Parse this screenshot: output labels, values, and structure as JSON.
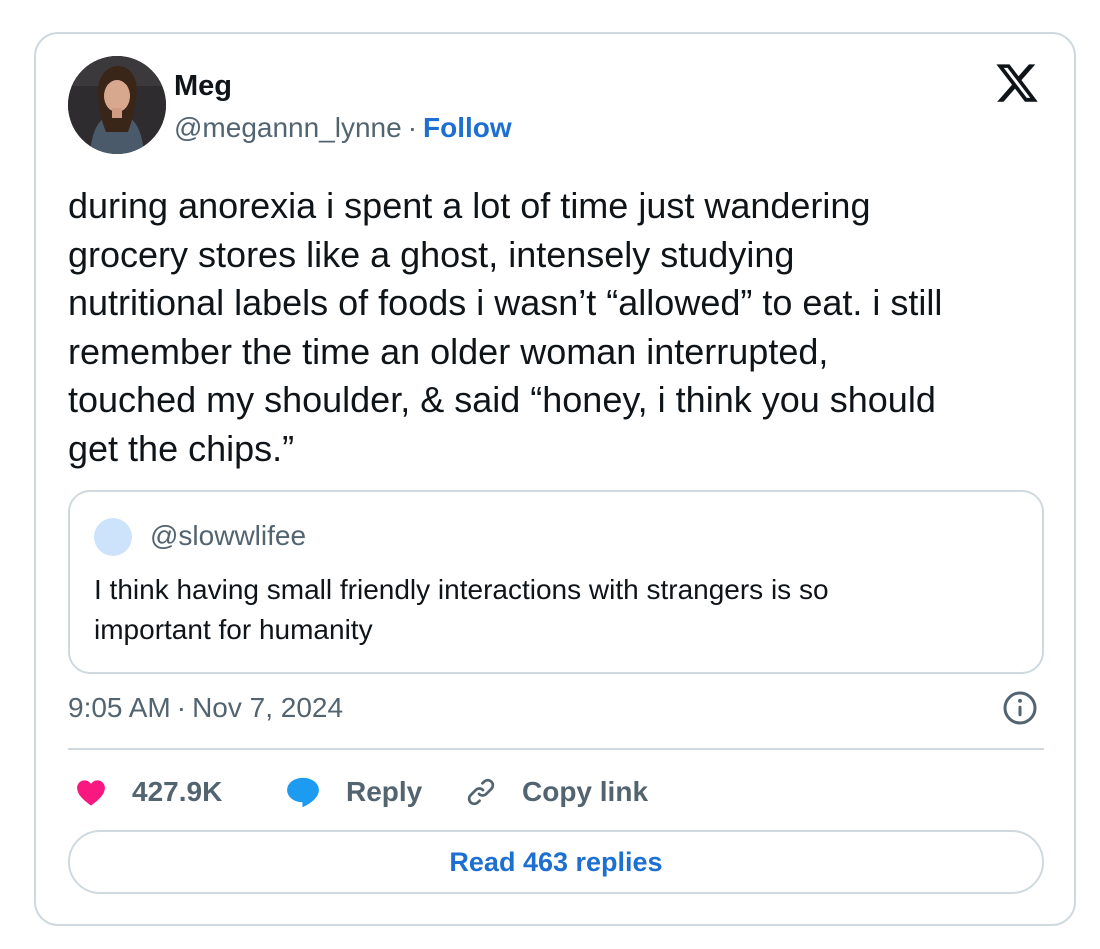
{
  "author": {
    "name": "Meg",
    "handle": "@megannn_lynne",
    "separator": "·",
    "follow_label": "Follow"
  },
  "tweet": {
    "lines": [
      "during anorexia i spent a lot of time just wandering",
      "grocery stores like a ghost, intensely studying",
      "nutritional labels of foods i wasn’t “allowed” to eat. i still",
      "remember the time an older woman interrupted,",
      "touched my shoulder, & said “honey, i think you should",
      "get the chips.”"
    ]
  },
  "quote": {
    "handle": "@slowwlifee",
    "lines": [
      "I think having small friendly interactions with strangers is so",
      "important for humanity"
    ]
  },
  "meta": {
    "time": "9:05 AM",
    "separator": "·",
    "date": "Nov 7, 2024"
  },
  "actions": {
    "likes": "427.9K",
    "reply_label": "Reply",
    "copy_label": "Copy link"
  },
  "read_replies_label": "Read 463 replies",
  "colors": {
    "like": "#f91880",
    "reply": "#1d9bf0",
    "link": "#1d6fd1",
    "secondary_text": "#536471",
    "border": "#cfd9de"
  },
  "icons": [
    "x-logo-icon",
    "heart-icon",
    "reply-bubble-icon",
    "link-icon",
    "info-icon"
  ]
}
